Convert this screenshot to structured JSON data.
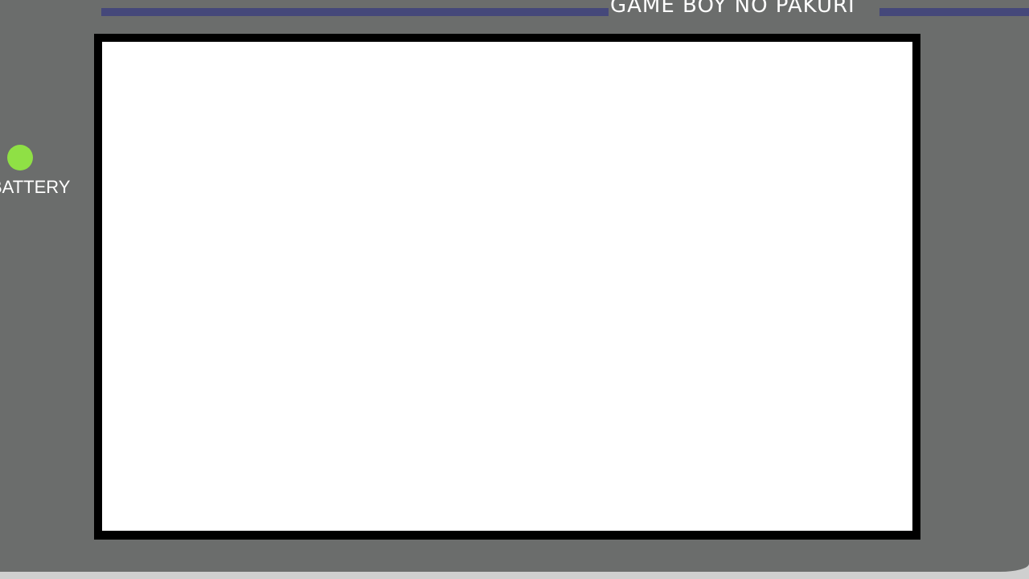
{
  "header": {
    "title": "GAME BOY NO PAKURI"
  },
  "battery": {
    "label": "BATTERY",
    "led_color": "#8fe045"
  },
  "colors": {
    "body": "#6b6d6c",
    "stripe": "#45487a",
    "bezel": "#000000",
    "screen": "#ffffff",
    "text": "#ffffff"
  }
}
